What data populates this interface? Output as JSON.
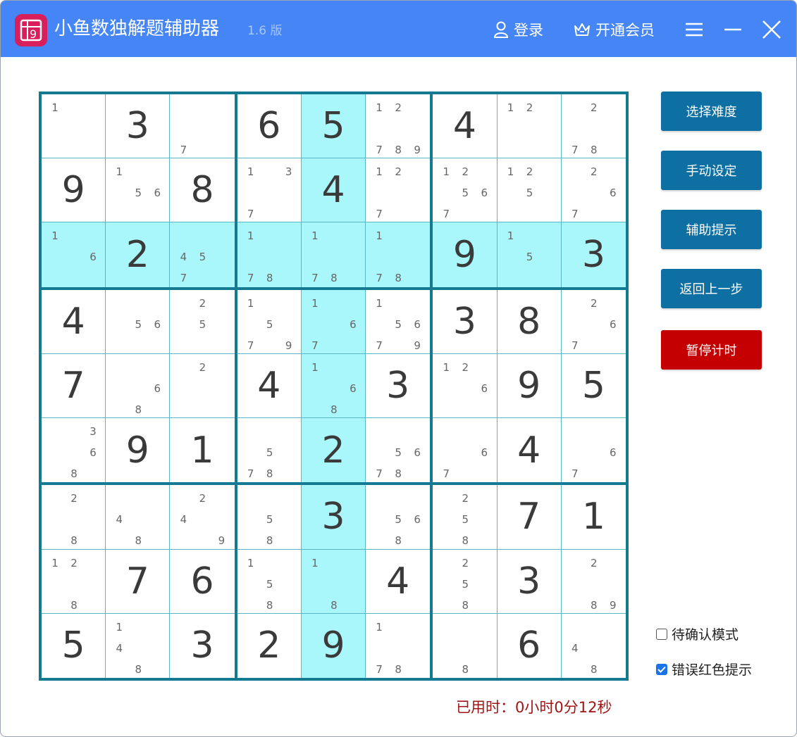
{
  "app": {
    "title": "小鱼数独解题辅助器",
    "version": "1.6 版",
    "logo_icon": "sudoku-grid-icon",
    "brand_color": "#4585f5"
  },
  "titlebar": {
    "login_label": "登录",
    "vip_label": "开通会员",
    "menu_icon": "hamburger-icon",
    "minimize_icon": "minimize-icon",
    "close_icon": "close-icon"
  },
  "sidebar": {
    "buttons": [
      {
        "label": "选择难度",
        "color": "#0e6fa3"
      },
      {
        "label": "手动设定",
        "color": "#0e6fa3"
      },
      {
        "label": "辅助提示",
        "color": "#0e6fa3"
      },
      {
        "label": "返回上一步",
        "color": "#0e6fa3"
      },
      {
        "label": "暂停计时",
        "color": "#c40000"
      }
    ],
    "checkboxes": [
      {
        "label": "待确认模式",
        "checked": false
      },
      {
        "label": "错误红色提示",
        "checked": true
      }
    ]
  },
  "timer": {
    "text": "已用时：0小时0分12秒"
  },
  "board": {
    "highlight_color": "#a9f6fb",
    "highlight_row": 2,
    "highlight_col": 4,
    "rows": [
      [
        {
          "c": [
            1
          ]
        },
        {
          "v": 3
        },
        {
          "c": [
            7
          ]
        },
        {
          "v": 6
        },
        {
          "v": 5
        },
        {
          "c": [
            1,
            2,
            7,
            8,
            9
          ]
        },
        {
          "v": 4
        },
        {
          "c": [
            1,
            2
          ]
        },
        {
          "c": [
            2,
            7,
            8
          ]
        }
      ],
      [
        {
          "v": 9
        },
        {
          "c": [
            1,
            5,
            6
          ]
        },
        {
          "v": 8
        },
        {
          "c": [
            1,
            3,
            7
          ]
        },
        {
          "v": 4
        },
        {
          "c": [
            1,
            2,
            7
          ]
        },
        {
          "c": [
            1,
            2,
            5,
            6,
            7
          ]
        },
        {
          "c": [
            1,
            2,
            5
          ]
        },
        {
          "c": [
            2,
            6,
            7
          ]
        }
      ],
      [
        {
          "c": [
            1,
            6
          ]
        },
        {
          "v": 2
        },
        {
          "c": [
            4,
            5,
            7
          ]
        },
        {
          "c": [
            1,
            7,
            8
          ]
        },
        {
          "c": [
            1,
            7,
            8
          ]
        },
        {
          "c": [
            1,
            7,
            8
          ]
        },
        {
          "v": 9
        },
        {
          "c": [
            1,
            5
          ]
        },
        {
          "v": 3
        }
      ],
      [
        {
          "v": 4
        },
        {
          "c": [
            5,
            6
          ]
        },
        {
          "c": [
            2,
            5
          ]
        },
        {
          "c": [
            1,
            5,
            7,
            9
          ]
        },
        {
          "c": [
            1,
            6,
            7
          ]
        },
        {
          "c": [
            1,
            5,
            6,
            7,
            9
          ]
        },
        {
          "v": 3
        },
        {
          "v": 8
        },
        {
          "c": [
            2,
            6,
            7
          ]
        }
      ],
      [
        {
          "v": 7
        },
        {
          "c": [
            6,
            8
          ]
        },
        {
          "c": [
            2
          ]
        },
        {
          "v": 4
        },
        {
          "c": [
            1,
            6,
            8
          ]
        },
        {
          "v": 3
        },
        {
          "c": [
            1,
            2,
            6
          ]
        },
        {
          "v": 9
        },
        {
          "v": 5
        }
      ],
      [
        {
          "c": [
            3,
            6,
            8
          ]
        },
        {
          "v": 9
        },
        {
          "v": 1
        },
        {
          "c": [
            5,
            7,
            8
          ]
        },
        {
          "v": 2
        },
        {
          "c": [
            5,
            6,
            7,
            8
          ]
        },
        {
          "c": [
            6,
            7
          ]
        },
        {
          "v": 4
        },
        {
          "c": [
            6,
            7
          ]
        }
      ],
      [
        {
          "c": [
            2,
            8
          ]
        },
        {
          "c": [
            4,
            8
          ]
        },
        {
          "c": [
            2,
            4,
            9
          ]
        },
        {
          "c": [
            5,
            8
          ]
        },
        {
          "v": 3
        },
        {
          "c": [
            5,
            6,
            8
          ]
        },
        {
          "c": [
            2,
            5,
            8
          ]
        },
        {
          "v": 7
        },
        {
          "v": 1
        }
      ],
      [
        {
          "c": [
            1,
            2,
            8
          ]
        },
        {
          "v": 7
        },
        {
          "v": 6
        },
        {
          "c": [
            1,
            5,
            8
          ]
        },
        {
          "c": [
            1,
            8
          ]
        },
        {
          "v": 4
        },
        {
          "c": [
            2,
            5,
            8
          ]
        },
        {
          "v": 3
        },
        {
          "c": [
            2,
            8,
            9
          ]
        }
      ],
      [
        {
          "v": 5
        },
        {
          "c": [
            1,
            4,
            8
          ]
        },
        {
          "v": 3
        },
        {
          "v": 2
        },
        {
          "v": 9
        },
        {
          "c": [
            1,
            7,
            8
          ]
        },
        {
          "c": [
            8
          ]
        },
        {
          "v": 6
        },
        {
          "c": [
            4,
            8
          ]
        }
      ]
    ]
  }
}
